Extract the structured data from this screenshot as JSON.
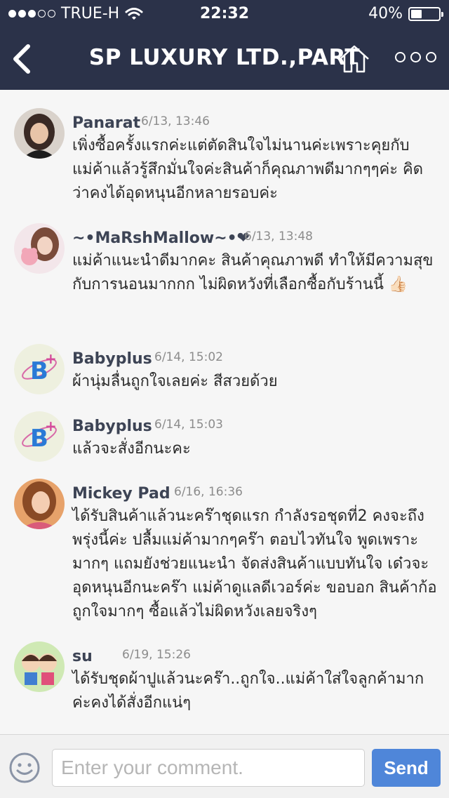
{
  "status_bar": {
    "carrier": "TRUE-H",
    "signal_dots_filled": 3,
    "signal_dots_total": 5,
    "time": "22:32",
    "battery_percent": "40%",
    "battery_level": 0.4
  },
  "header": {
    "title": "SP LUXURY LTD.,PART",
    "back_icon": "chevron-left-icon",
    "home_icon": "home-icon",
    "more_icon": "more-options-icon",
    "background": "#2b3249"
  },
  "comments": [
    {
      "name": "Panarat",
      "date": "6/13, 13:46",
      "text": "เพิ่งซื้อครั้งแรกค่ะแต่ตัดสินใจไม่นานค่ะเพราะคุยกับแม่ค้าแล้วรู้สึกมั่นใจค่ะสินค้าก็คุณภาพดีมากๆๆค่ะ คิดว่าคงได้อุดหนุนอีกหลายรอบค่ะ"
    },
    {
      "name": "~•MaRshMallow~•❤",
      "date": "6/13, 13:48",
      "text": "แม่ค้าแนะนำดีมากคะ สินค้าคุณภาพดี ทำให้มีความสุขกับการนอนมากกก ไม่ผิดหวังที่เลือกซื้อกับร้านนี้ 👍🏻"
    },
    {
      "name": "Babyplus",
      "date": "6/14, 15:02",
      "text": "ผ้านุ่มลื่นถูกใจเลยค่ะ สีสวยด้วย"
    },
    {
      "name": "Babyplus",
      "date": "6/14, 15:03",
      "text": "แล้วจะสั่งอีกนะคะ"
    },
    {
      "name": "Mickey Pad",
      "date": "6/16, 16:36",
      "text": "ได้รับสินค้าแล้วนะคร๊าชุดแรก กำลังรอชุดที่2 คงจะถึงพรุ่งนี้ค่ะ ปลื้มแม่ค้ามากๆคร๊า ตอบไวทันใจ พูดเพราะมากๆ แถมยังช่วยแนะนำ จัดส่งสินค้าแบบทันใจ เด๋วจะอุดหนุนอีกนะคร๊า แม่ค้าดูแลดีเวอร์ค่ะ ขอบอก สินค้าก้อถูกใจมากๆ ซื้อแล้วไม่ผิดหวังเลยจริงๆ"
    },
    {
      "name": "su",
      "date": "6/19, 15:26",
      "text": "ได้รับชุดผ้าปูแล้วนะคร๊า..ถูกใจ..แม่ค้าใส่ใจลูกค้ามากค่ะคงได้สั่งอีกแน่ๆ"
    }
  ],
  "composer": {
    "placeholder": "Enter your comment.",
    "value": "",
    "send_label": "Send",
    "smiley_icon": "smiley-icon",
    "send_color": "#4f86d9"
  }
}
